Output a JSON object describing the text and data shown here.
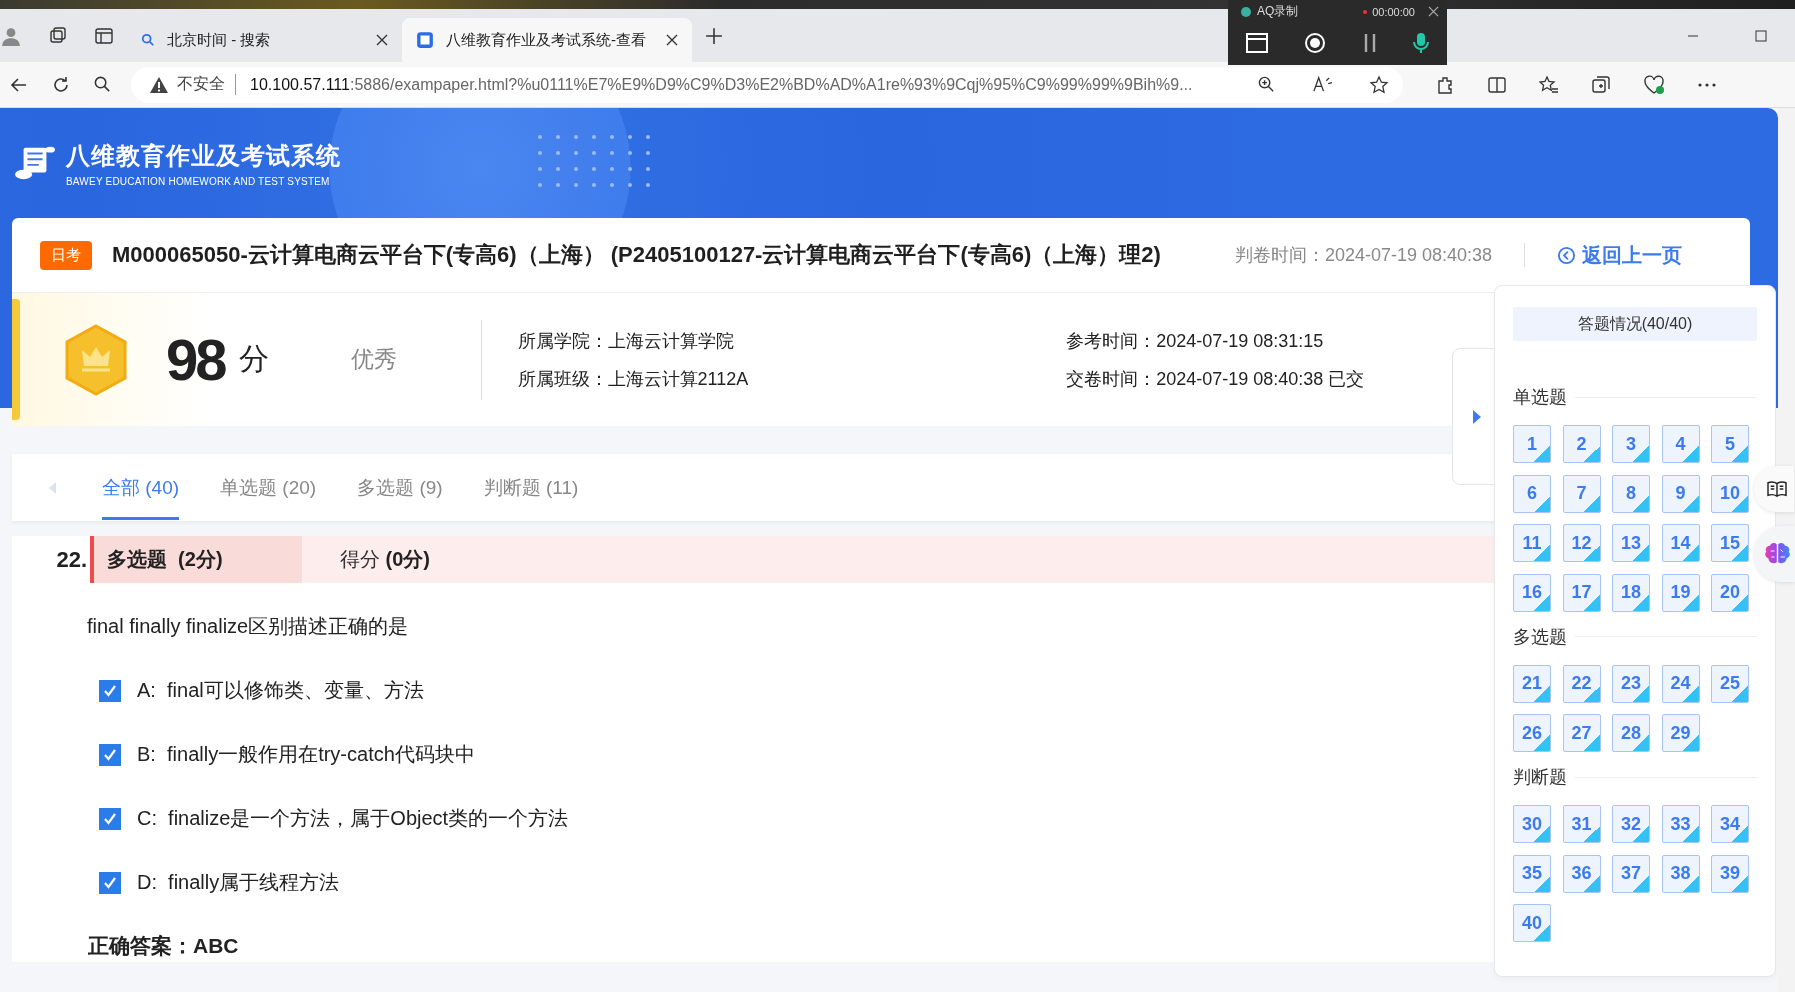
{
  "browser": {
    "tabs": [
      {
        "title": "北京时间 - 搜索",
        "selected": false
      },
      {
        "title": "八维教育作业及考试系统-查看",
        "selected": true
      }
    ],
    "security": "不安全",
    "url_host": "10.100.57.111",
    "url_rest": ":5886/exampaper.html?%u0111%E7%E9%D9%C9%D3%E2%BD%AD%A1re%93%9Cqj%95%C9%99%99%9Bih%9..."
  },
  "recorder": {
    "title": "AQ录制",
    "time": "00:00:00"
  },
  "header": {
    "title": "八维教育作业及考试系统",
    "subtitle": "BAWEY EDUCATION HOMEWORK AND TEST SYSTEM"
  },
  "exam": {
    "tag": "日考",
    "title": "M000065050-云计算电商云平台下(专高6)（上海） (P2405100127-云计算电商云平台下(专高6)（上海）理2)",
    "graded_label": "判卷时间：",
    "graded_time": "2024-07-19 08:40:38",
    "back": "返回上一页"
  },
  "score": {
    "value": "98",
    "unit": "分",
    "grade": "优秀",
    "info": [
      {
        "label": "所属学院：",
        "value": "上海云计算学院"
      },
      {
        "label": "所属班级：",
        "value": "上海云计算2112A"
      }
    ],
    "times": [
      {
        "label": "参考时间：",
        "value": "2024-07-19 08:31:15"
      },
      {
        "label": "交卷时间：",
        "value": "2024-07-19 08:40:38 已交"
      }
    ]
  },
  "tabs": [
    {
      "label": "全部 (40)",
      "selected": true
    },
    {
      "label": "单选题 (20)",
      "selected": false
    },
    {
      "label": "多选题 (9)",
      "selected": false
    },
    {
      "label": "判断题 (11)",
      "selected": false
    }
  ],
  "question": {
    "number": "22.",
    "type": "多选题  (2分)",
    "score_label": "得分",
    "score": "(0分)",
    "stem": "final finally finalize区别描述正确的是",
    "options": [
      {
        "letter": "A:",
        "text": "final可以修饰类、变量、方法",
        "checked": true
      },
      {
        "letter": "B:",
        "text": "finally一般作用在try-catch代码块中",
        "checked": true
      },
      {
        "letter": "C:",
        "text": "finalize是一个方法，属于Object类的一个方法",
        "checked": true
      },
      {
        "letter": "D:",
        "text": "finally属于线程方法",
        "checked": true
      }
    ],
    "answer_label": "正确答案：",
    "answer": "ABC"
  },
  "sheet": {
    "summary": "答题情况(40/40)",
    "sections": [
      {
        "title": "单选题",
        "items": [
          {
            "n": "1",
            "answered": true
          },
          {
            "n": "2",
            "answered": true
          },
          {
            "n": "3",
            "answered": true
          },
          {
            "n": "4",
            "answered": true
          },
          {
            "n": "5",
            "answered": true
          },
          {
            "n": "6",
            "answered": true
          },
          {
            "n": "7",
            "answered": true
          },
          {
            "n": "8",
            "answered": true
          },
          {
            "n": "9",
            "answered": true
          },
          {
            "n": "10",
            "answered": true
          },
          {
            "n": "11",
            "answered": true
          },
          {
            "n": "12",
            "answered": true
          },
          {
            "n": "13",
            "answered": true
          },
          {
            "n": "14",
            "answered": true
          },
          {
            "n": "15",
            "answered": true
          },
          {
            "n": "16",
            "answered": true
          },
          {
            "n": "17",
            "answered": true
          },
          {
            "n": "18",
            "answered": true
          },
          {
            "n": "19",
            "answered": true
          },
          {
            "n": "20",
            "answered": true
          }
        ]
      },
      {
        "title": "多选题",
        "items": [
          {
            "n": "21",
            "answered": true
          },
          {
            "n": "22",
            "answered": true
          },
          {
            "n": "23",
            "answered": true
          },
          {
            "n": "24",
            "answered": true
          },
          {
            "n": "25",
            "answered": true
          },
          {
            "n": "26",
            "answered": true
          },
          {
            "n": "27",
            "answered": true
          },
          {
            "n": "28",
            "answered": true
          },
          {
            "n": "29",
            "answered": true
          }
        ]
      },
      {
        "title": "判断题",
        "items": [
          {
            "n": "30",
            "answered": true
          },
          {
            "n": "31",
            "answered": true
          },
          {
            "n": "32",
            "answered": true
          },
          {
            "n": "33",
            "answered": true
          },
          {
            "n": "34",
            "answered": true
          },
          {
            "n": "35",
            "answered": true
          },
          {
            "n": "36",
            "answered": true
          },
          {
            "n": "37",
            "answered": true
          },
          {
            "n": "38",
            "answered": true
          },
          {
            "n": "39",
            "answered": true
          },
          {
            "n": "40",
            "answered": true
          }
        ]
      }
    ]
  }
}
